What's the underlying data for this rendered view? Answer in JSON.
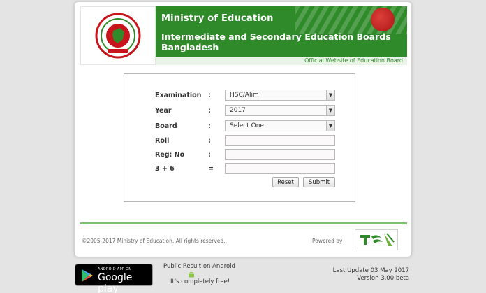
{
  "header": {
    "ministry": "Ministry of Education",
    "boards": "Intermediate and Secondary Education Boards Bangladesh",
    "official": "Official Website of Education Board"
  },
  "form": {
    "rows": [
      {
        "label": "Examination",
        "value": "HSC/Alim",
        "kind": "select"
      },
      {
        "label": "Year",
        "value": "2017",
        "kind": "select"
      },
      {
        "label": "Board",
        "value": "Select One",
        "kind": "select"
      },
      {
        "label": "Roll",
        "value": "",
        "kind": "input"
      },
      {
        "label": "Reg: No",
        "value": "",
        "kind": "input"
      },
      {
        "label": "3 + 6",
        "value": "",
        "kind": "input"
      }
    ],
    "colon_examination": ":",
    "colon_year": ":",
    "colon_board": ":",
    "colon_roll": ":",
    "colon_reg": ":",
    "colon_captcha": "=",
    "reset_label": "Reset",
    "submit_label": "Submit"
  },
  "footer": {
    "copyright": "©2005-2017 Ministry of Education. All rights reserved.",
    "powered": "Powered by"
  },
  "bottom": {
    "gplay_small": "ANDROID APP ON",
    "gplay_big": "Google play",
    "android_title": "Public Result on Android",
    "android_free": "It's completely free!",
    "last_update": "Last Update 03 May 2017",
    "version": "Version 3.00 beta"
  },
  "colors": {
    "green": "#2f8a2a",
    "red": "#c8141b"
  },
  "icons": {
    "seal": "bangladesh-govt-seal-icon",
    "play": "google-play-icon",
    "android": "android-robot-icon",
    "teletalk": "teletalk-logo-icon"
  }
}
